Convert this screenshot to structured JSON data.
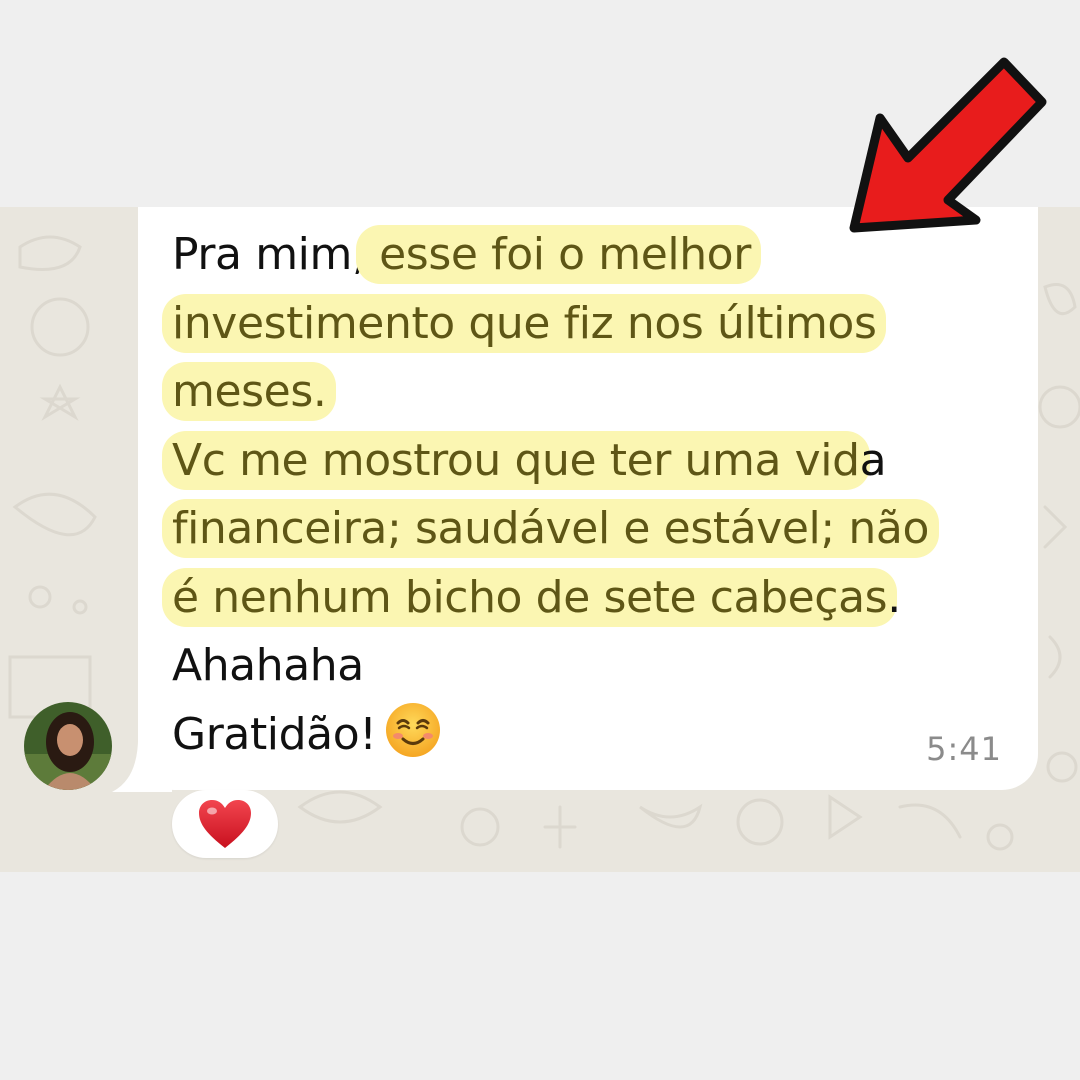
{
  "message": {
    "lines": [
      {
        "plain_before": "Pra mim,",
        "highlight": " esse foi o melhor",
        "plain_after": ""
      },
      {
        "plain_before": "",
        "highlight": "investimento que fiz nos últimos",
        "plain_after": ""
      },
      {
        "plain_before": "",
        "highlight": "meses.",
        "plain_after": ""
      },
      {
        "plain_before": "",
        "highlight": "Vc me mostrou que ter uma vid",
        "plain_after": "a"
      },
      {
        "plain_before": "",
        "highlight": "financeira; saudável e estável; não",
        "plain_after": ""
      },
      {
        "plain_before": "",
        "highlight": "é nenhum bicho de sete cabeças",
        "plain_after": "."
      },
      {
        "plain_before": "Ahahaha",
        "highlight": "",
        "plain_after": ""
      },
      {
        "plain_before": "Gratidão!",
        "highlight": "",
        "plain_after": ""
      }
    ],
    "emoji": "smiling-face-emoji",
    "time": "5:41"
  },
  "reaction": {
    "icon": "red-heart-icon"
  },
  "avatar": {
    "icon": "contact-avatar"
  },
  "annotation": {
    "icon": "red-arrow-icon"
  },
  "colors": {
    "page_background": "#efefef",
    "chat_background": "#e9e6de",
    "bubble": "#ffffff",
    "highlight": "#fbf6b2",
    "highlight_text": "#5e5616",
    "arrow_fill": "#e81c1c",
    "heart": "#e0212e",
    "time_text": "#8b8b8b"
  }
}
